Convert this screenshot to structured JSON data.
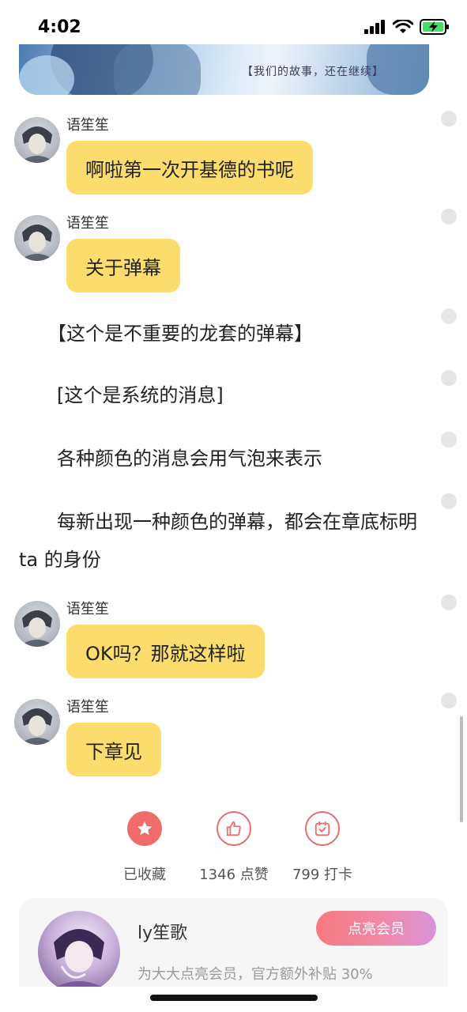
{
  "status_bar": {
    "time": "4:02"
  },
  "banner": {
    "caption": "【我们的故事，还在继续】"
  },
  "messages": [
    {
      "sender": "语笙笙",
      "text": "啊啦第一次开基德的书呢"
    },
    {
      "sender": "语笙笙",
      "text": "关于弹幕"
    },
    {
      "sender": "语笙笙",
      "text": "OK吗？那就这样啦"
    },
    {
      "sender": "语笙笙",
      "text": "下章见"
    }
  ],
  "paragraphs": [
    "　　【这个是不重要的龙套的弹幕】",
    "　　[这个是系统的消息]",
    "　　各种颜色的消息会用气泡来表示",
    "　　每新出现一种颜色的弹幕，都会在章底标明 ta 的身份"
  ],
  "actions": {
    "favorite_label": "已收藏",
    "like_label": "1346 点赞",
    "checkin_label": "799 打卡"
  },
  "member": {
    "name": "ly笙歌",
    "button_label": "点亮会员",
    "description": "为大大点亮会员，官方额外补贴 30%"
  },
  "colors": {
    "bubble": "#fcdc6c",
    "accent_red": "#f06b6b",
    "member_gradient_start": "#f6797f",
    "member_gradient_end": "#d894d6"
  },
  "icons": {
    "favorite": "star-icon",
    "like": "thumbs-up-icon",
    "checkin": "calendar-check-icon"
  }
}
